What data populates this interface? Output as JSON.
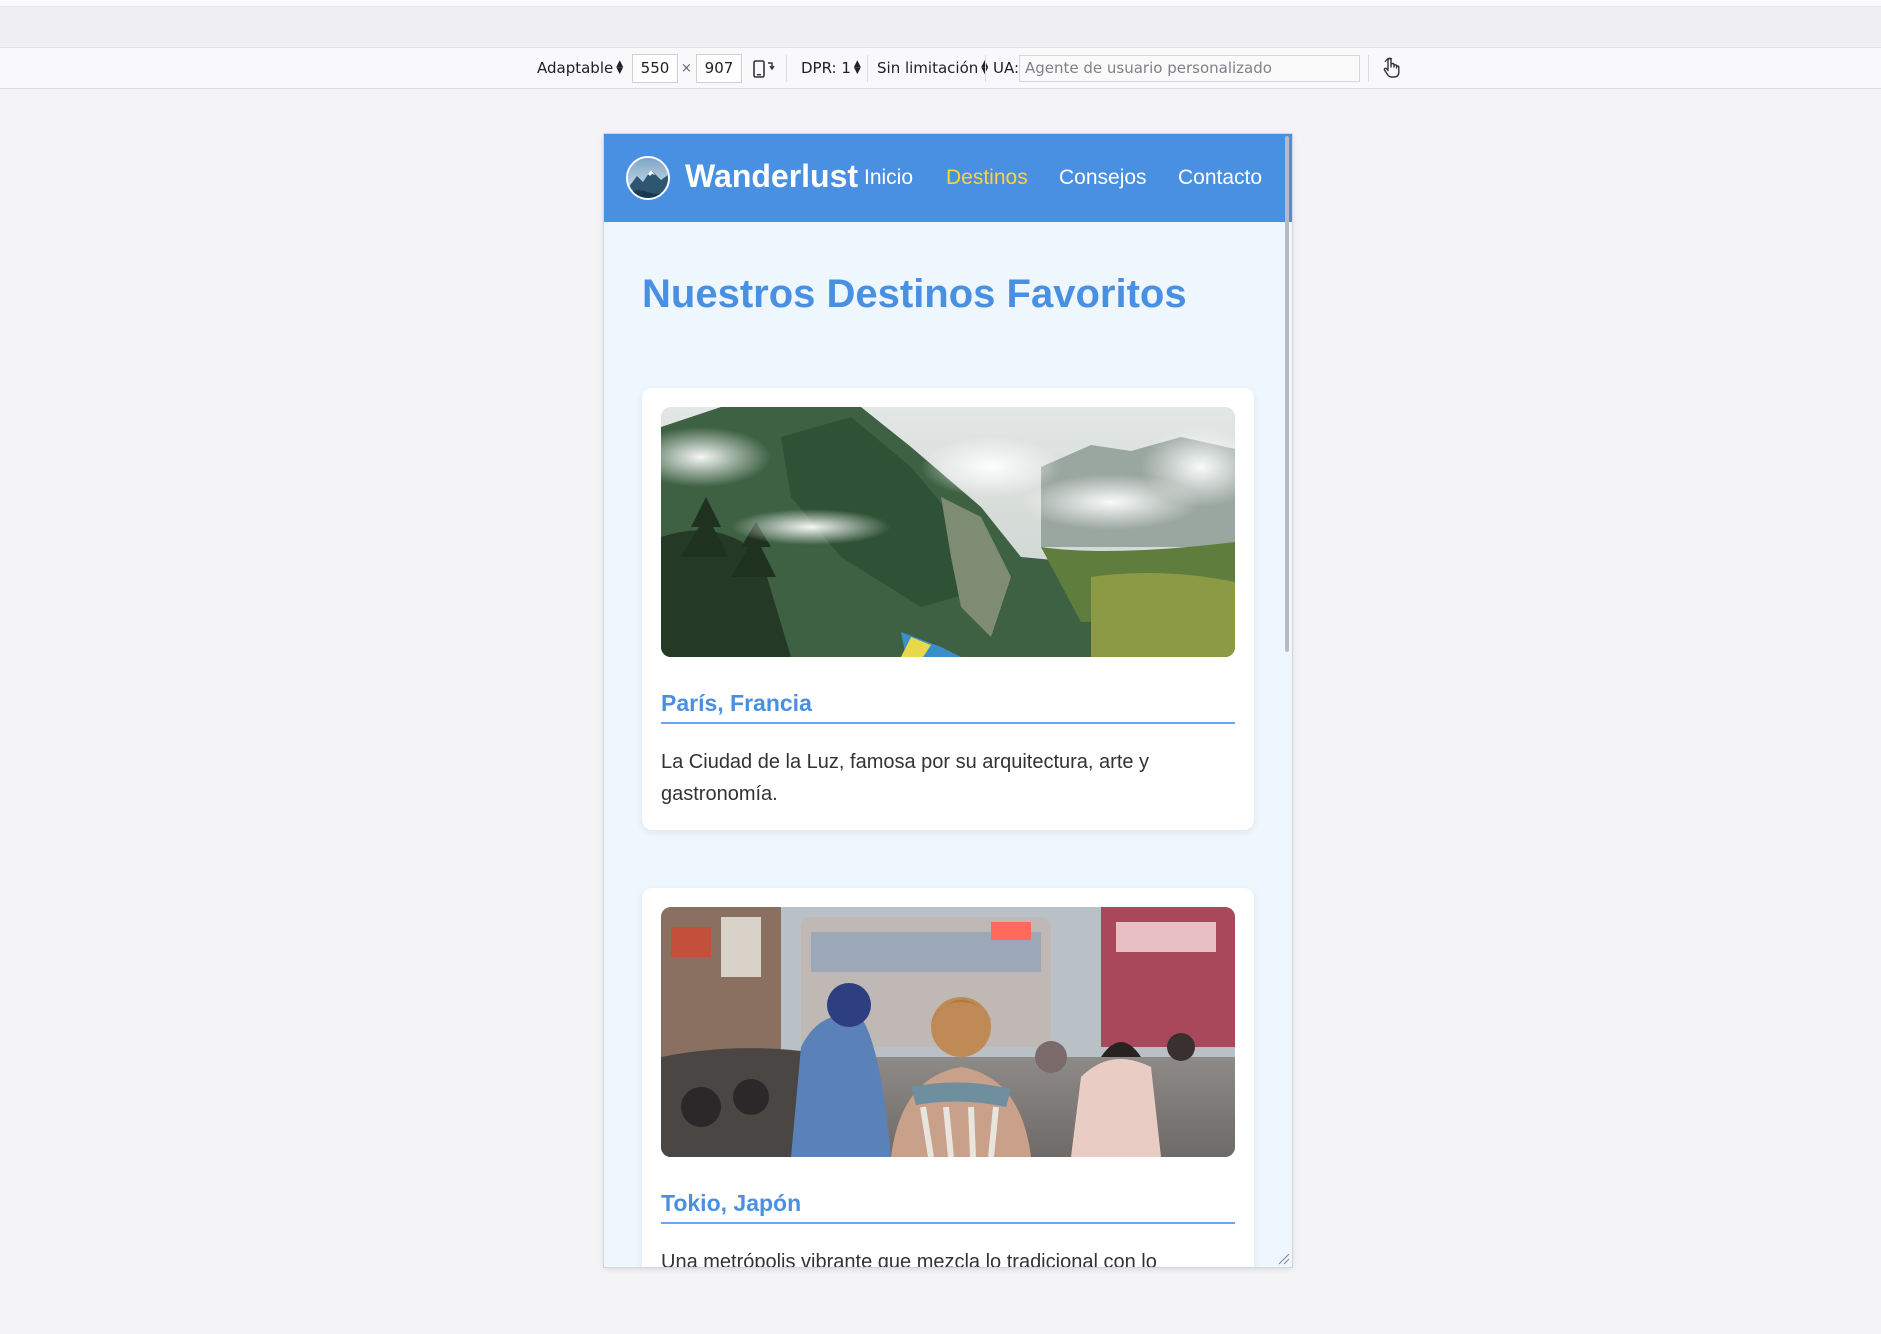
{
  "devtools": {
    "device": "Adaptable",
    "width": "550",
    "times": "×",
    "height": "907",
    "dpr": "DPR: 1",
    "throttle": "Sin limitación",
    "ua_label": "UA:",
    "ua_placeholder": "Agente de usuario personalizado"
  },
  "site": {
    "brand": "Wanderlust",
    "nav": [
      {
        "label": "Inicio",
        "active": false
      },
      {
        "label": "Destinos",
        "active": true
      },
      {
        "label": "Consejos",
        "active": false
      },
      {
        "label": "Contacto",
        "active": false
      }
    ],
    "page_title": "Nuestros Destinos Favoritos",
    "cards": [
      {
        "title": "París, Francia",
        "description": "La Ciudad de la Luz, famosa por su arquitectura, arte y gastronomía."
      },
      {
        "title": "Tokio, Japón",
        "description": "Una metrópolis vibrante que mezcla lo tradicional con lo"
      }
    ]
  },
  "colors": {
    "primary": "#4a90e2",
    "active_link": "#ffd23f",
    "page_bg": "#eef6fe",
    "card_bg": "#ffffff"
  }
}
